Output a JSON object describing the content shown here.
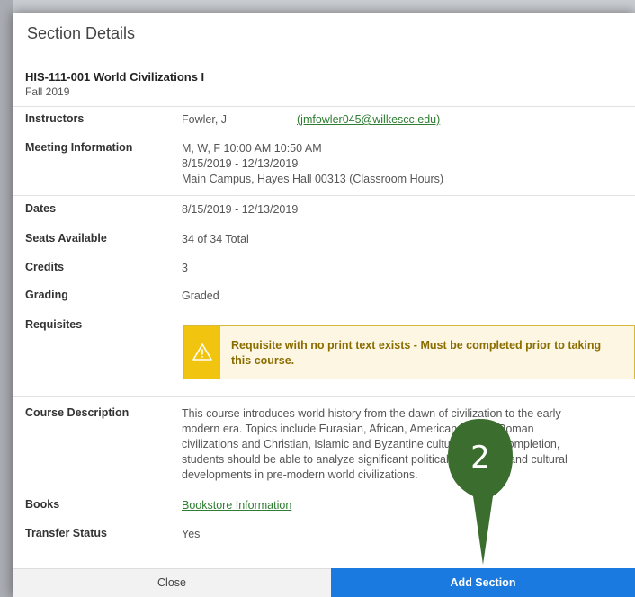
{
  "modal": {
    "title": "Section Details"
  },
  "course": {
    "code_title": "HIS-111-001 World Civilizations I",
    "term": "Fall 2019"
  },
  "details": {
    "instructors": {
      "label": "Instructors",
      "name": "Fowler, J",
      "email": "(jmfowler045@wilkescc.edu)"
    },
    "meeting": {
      "label": "Meeting Information",
      "line1": "M, W, F 10:00 AM 10:50 AM",
      "line2": "8/15/2019 - 12/13/2019",
      "line3": "Main Campus, Hayes Hall 00313 (Classroom Hours)"
    },
    "dates": {
      "label": "Dates",
      "value": "8/15/2019 - 12/13/2019"
    },
    "seats": {
      "label": "Seats Available",
      "value": "34 of 34 Total"
    },
    "credits": {
      "label": "Credits",
      "value": "3"
    },
    "grading": {
      "label": "Grading",
      "value": "Graded"
    },
    "requisites": {
      "label": "Requisites",
      "warning_line1": "Requisite with no print text exists - Must be completed prior to taking",
      "warning_line2": "this course."
    },
    "description": {
      "label": "Course Description",
      "lines": [
        "This course introduces world history from the dawn of civilization to the early",
        "modern era. Topics include Eurasian, African, American, Greco-Roman",
        "civilizations and Christian, Islamic and Byzantine cultures. Upon completion,",
        "students should be able to analyze significant political, economic, and cultural",
        "developments in pre-modern world civilizations."
      ]
    },
    "books": {
      "label": "Books",
      "link": "Bookstore Information"
    },
    "transfer": {
      "label": "Transfer Status",
      "value": "Yes"
    }
  },
  "footer": {
    "close_label": "Close",
    "add_label": "Add Section"
  },
  "callout": {
    "number": "2",
    "color": "#3b6e2e"
  },
  "colors": {
    "accent_blue": "#1a7ae0",
    "link_green": "#2e7d32",
    "warning_yellow": "#f1c40f"
  }
}
